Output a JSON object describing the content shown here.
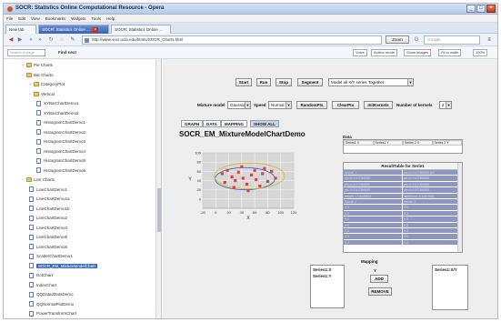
{
  "window": {
    "title": "SOCR: Statistics Online Computational Resource - Opera",
    "controls": {
      "minimize": "_",
      "maximize": "□",
      "close": "×"
    }
  },
  "menubar": [
    "File",
    "Edit",
    "View",
    "Bookmarks",
    "Widgets",
    "Tools",
    "Help"
  ],
  "tabs": [
    {
      "label": "New tab",
      "active": false
    },
    {
      "label": "SOCR: Statistics Online ...",
      "active": true
    },
    {
      "label": "SOCR: Statistics Online ...",
      "active": false
    }
  ],
  "address": {
    "url": "http://www.socr.ucla.edu/htmls/SOCR_Charts.html",
    "zoom": "Zoom",
    "search_placeholder": "Google"
  },
  "findbar": {
    "find_placeholder": "Search in page",
    "find_label": "Find next",
    "buttons": [
      "Voice",
      "Author mode",
      "Show images",
      "Fit to width",
      "100%"
    ]
  },
  "tree": {
    "items": [
      {
        "label": "Pie Charts",
        "kind": "folder",
        "level": 1,
        "expander": "+"
      },
      {
        "label": "Bar Charts",
        "kind": "folder",
        "level": 1,
        "expander": "−"
      },
      {
        "label": "CategoryPlot",
        "kind": "folder",
        "level": 2,
        "expander": "+"
      },
      {
        "label": "Vertical",
        "kind": "folder",
        "level": 2,
        "expander": "−"
      },
      {
        "label": "XYBarChartDemo1",
        "kind": "file",
        "level": 3
      },
      {
        "label": "XYBarChartDemo2",
        "kind": "file",
        "level": 3
      },
      {
        "label": "HistogramChartDemo1",
        "kind": "file",
        "level": 3
      },
      {
        "label": "HistogramChartDemo2",
        "kind": "file",
        "level": 3
      },
      {
        "label": "HistogramChartDemo3",
        "kind": "file",
        "level": 3
      },
      {
        "label": "HistogramChartDemo4",
        "kind": "file",
        "level": 3
      },
      {
        "label": "HistogramChartDemo5",
        "kind": "file",
        "level": 3
      },
      {
        "label": "HistogramChartDemo6",
        "kind": "file",
        "level": 3
      },
      {
        "label": "Line Charts",
        "kind": "folder",
        "level": 1,
        "expander": "−"
      },
      {
        "label": "LineChartDemo1",
        "kind": "file",
        "level": 2
      },
      {
        "label": "LineChartDemo1a",
        "kind": "file",
        "level": 2
      },
      {
        "label": "LineChartDemo1b",
        "kind": "file",
        "level": 2
      },
      {
        "label": "LineChartDemo2",
        "kind": "file",
        "level": 2
      },
      {
        "label": "LineChartDemo3",
        "kind": "file",
        "level": 2
      },
      {
        "label": "LineChartDemo5",
        "kind": "file",
        "level": 2
      },
      {
        "label": "LineChartDemo6",
        "kind": "file",
        "level": 2
      },
      {
        "label": "ScatterChartDemo1",
        "kind": "file",
        "level": 2
      },
      {
        "label": "SOCR_EM_MixtureModelChart",
        "kind": "file",
        "level": 2,
        "selected": true
      },
      {
        "label": "DotChart",
        "kind": "file",
        "level": 2
      },
      {
        "label": "IndexChart",
        "kind": "file",
        "level": 2
      },
      {
        "label": "QQData2DataDemo",
        "kind": "file",
        "level": 2
      },
      {
        "label": "QQNormalPlotDemo",
        "kind": "file",
        "level": 2
      },
      {
        "label": "PowerTransformChart",
        "kind": "file",
        "level": 2
      }
    ]
  },
  "controls": {
    "buttons": [
      "Start",
      "Run",
      "Stop",
      "Segment"
    ],
    "mode_combo": "Model all X/Y series Together",
    "mixture_label": "Mixture model",
    "mixture_value": "Gaussian",
    "speed_label": "Speed",
    "speed_value": "Normal",
    "btn_random": "RandomPts",
    "btn_clear": "ClearPts",
    "btn_init": "InitKernels",
    "kernels_label": "Number of kernels",
    "kernels_value": "2"
  },
  "view_tabs": [
    {
      "label": "GRAPH",
      "active": false
    },
    {
      "label": "DATA",
      "active": false
    },
    {
      "label": "MAPPING",
      "active": false
    },
    {
      "label": "SHOW ALL",
      "active": true
    }
  ],
  "chart": {
    "title": "SOCR_EM_MixtureModelChartDemo",
    "xlabel": "X",
    "ylabel": "Y"
  },
  "chart_data": {
    "type": "scatter",
    "title": "SOCR_EM_MixtureModelChartDemo",
    "xlabel": "X",
    "ylabel": "Y",
    "xlim": [
      -20,
      120
    ],
    "ylim": [
      -20,
      100
    ],
    "xticks": [
      -20,
      0,
      20,
      40,
      60,
      80,
      100,
      120
    ],
    "yticks": [
      0,
      20,
      40,
      60,
      80,
      100
    ],
    "grid": true,
    "series": [
      {
        "points": [
          [
            10,
            55
          ],
          [
            18,
            62
          ],
          [
            25,
            48
          ],
          [
            30,
            40
          ],
          [
            35,
            58
          ],
          [
            42,
            45
          ],
          [
            48,
            32
          ],
          [
            55,
            52
          ],
          [
            62,
            42
          ],
          [
            68,
            28
          ],
          [
            72,
            55
          ],
          [
            80,
            38
          ],
          [
            86,
            60
          ],
          [
            92,
            45
          ],
          [
            28,
            25
          ],
          [
            50,
            18
          ],
          [
            75,
            66
          ],
          [
            14,
            36
          ],
          [
            40,
            70
          ],
          [
            60,
            62
          ]
        ],
        "color": "#e0423a"
      }
    ],
    "kernels": [
      {
        "cx": 45,
        "cy": 44,
        "rx": 46,
        "ry": 24,
        "color": "#3355cc"
      },
      {
        "cx": 52,
        "cy": 50,
        "rx": 54,
        "ry": 28,
        "color": "#d6b52a"
      }
    ]
  },
  "data_panel": {
    "header": "Data",
    "columns": [
      "Series1 X",
      "Series1 Y",
      "Series 2 X",
      "Series 2 Y"
    ]
  },
  "result_table": {
    "title": "ResultTable for Serie1",
    "rows": [
      [
        "Kernel 1",
        "pts:4=0.47056585 pt1"
      ],
      [
        "pts:4=0.47056585",
        "pts:4=0.47056585"
      ],
      [
        "pts:4=0.47056585",
        "pts:4=0.47056585"
      ],
      [
        "pts:4=0.47056585",
        "pts:4=0.47056585"
      ],
      [
        "weight 1.14448821",
        "likelihood -4.1547666"
      ],
      [
        "Kernel 2",
        "Kernel 2"
      ],
      [
        "0.0",
        "0.0"
      ],
      [
        "0.0",
        "0.0"
      ],
      [
        "0.0",
        "0.0"
      ],
      [
        "0.0",
        "0.0"
      ],
      [
        "0.0",
        "0.0"
      ],
      [
        "0.0",
        "0.0"
      ],
      [
        "0.0",
        "0.0"
      ]
    ]
  },
  "mapping": {
    "left_list": [
      "Series1:X",
      "Series1:Y"
    ],
    "mapping_label": "Mapping",
    "axis_label": "Y",
    "add_button": "ADD",
    "remove_button": "REMOVE",
    "right_list_header": "Series1:X/Y"
  }
}
